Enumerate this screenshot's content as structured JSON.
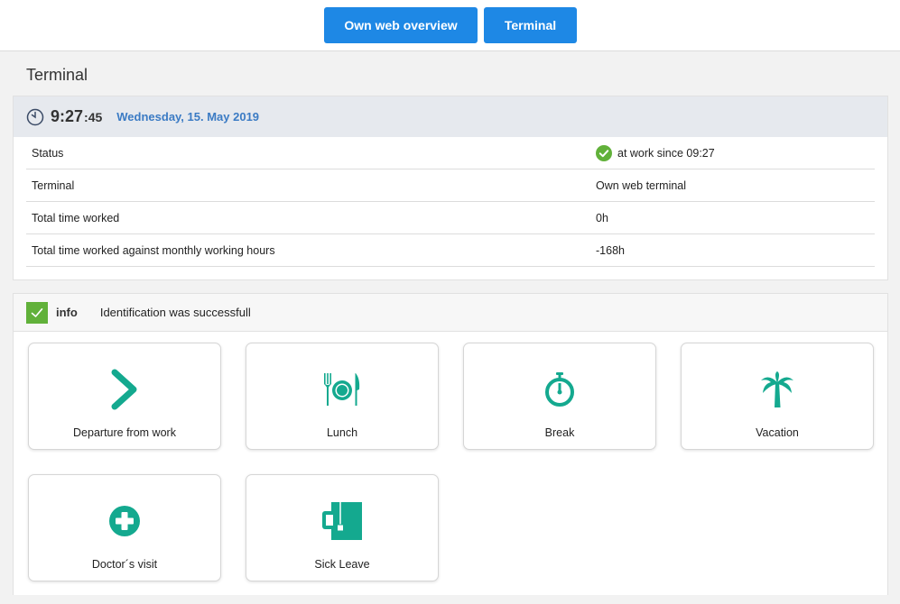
{
  "header": {
    "buttons": [
      {
        "label": "Own web overview"
      },
      {
        "label": "Terminal"
      }
    ]
  },
  "page": {
    "title": "Terminal"
  },
  "clock": {
    "time": "9:27",
    "seconds": ":45",
    "date": "Wednesday, 15. May 2019"
  },
  "status_rows": [
    {
      "label": "Status",
      "value": "at work since 09:27",
      "icon": "check-circle-icon"
    },
    {
      "label": "Terminal",
      "value": "Own web terminal"
    },
    {
      "label": "Total time worked",
      "value": "0h"
    },
    {
      "label": "Total time worked against monthly working hours",
      "value": "-168h"
    }
  ],
  "info": {
    "label": "info",
    "message": "Identification was successfull"
  },
  "actions": [
    {
      "label": "Departure from work",
      "icon": "chevron-right-icon"
    },
    {
      "label": "Lunch",
      "icon": "fork-plate-knife-icon"
    },
    {
      "label": "Break",
      "icon": "stopwatch-icon"
    },
    {
      "label": "Vacation",
      "icon": "palm-tree-icon"
    },
    {
      "label": "Doctor´s visit",
      "icon": "medical-cross-icon"
    },
    {
      "label": "Sick Leave",
      "icon": "sick-leave-icon"
    }
  ],
  "colors": {
    "primary_button": "#1e88e5",
    "action_icon": "#14a98f",
    "success": "#61b13a",
    "date_text": "#3b7bc4"
  }
}
